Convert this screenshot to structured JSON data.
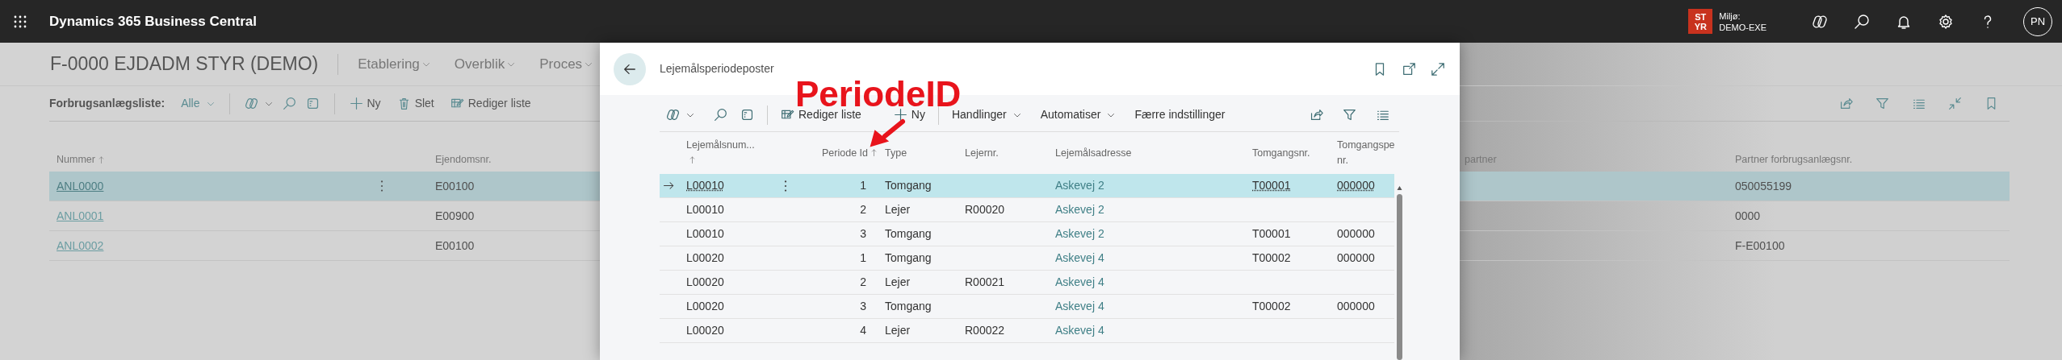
{
  "app_bar": {
    "title": "Dynamics 365 Business Central",
    "environment": {
      "badge_lines": [
        "ST",
        "YR"
      ],
      "label": "Miljø:",
      "name": "DEMO-EXE"
    },
    "avatar": "PN"
  },
  "page": {
    "title": "F-0000 EJDADM STYR (DEMO)",
    "nav": [
      {
        "label": "Etablering"
      },
      {
        "label": "Overblik"
      },
      {
        "label": "Proces"
      }
    ],
    "toolbar": {
      "list_label": "Forbrugsanlægsliste:",
      "filter": "Alle",
      "actions": [
        {
          "kind": "new",
          "label": "Ny"
        },
        {
          "kind": "delete",
          "label": "Slet"
        },
        {
          "kind": "edit",
          "label": "Rediger liste"
        }
      ]
    },
    "table": {
      "columns": [
        {
          "label": "Nummer",
          "sorted": true
        },
        {
          "label": "Ejendomsnr.",
          "sorted": false
        },
        {
          "label": "partner",
          "sorted": false
        },
        {
          "label": "Partner forbrugsanlægsnr.",
          "sorted": false
        }
      ],
      "rows": [
        {
          "selected": true,
          "number": "ANL0000",
          "property": "E00100",
          "partner_number": "050055199"
        },
        {
          "selected": false,
          "number": "ANL0001",
          "property": "E00900",
          "partner_number": "0000"
        },
        {
          "selected": false,
          "number": "ANL0002",
          "property": "E00100",
          "partner_number": "F-E00100"
        }
      ]
    }
  },
  "dialog": {
    "title": "Lejemålsperiodeposter",
    "toolbar": {
      "actions": [
        {
          "kind": "edit",
          "label": "Rediger liste"
        },
        {
          "kind": "new",
          "label": "Ny"
        }
      ],
      "menus": [
        {
          "label": "Handlinger"
        },
        {
          "label": "Automatiser"
        }
      ],
      "less": "Færre indstillinger"
    },
    "table": {
      "columns": [
        {
          "label": "Lejemålsnum...",
          "sorted": true
        },
        {
          "label": "Periode Id",
          "sorted": true
        },
        {
          "label": "Type",
          "sorted": false
        },
        {
          "label": "Lejernr.",
          "sorted": false
        },
        {
          "label": "Lejemålsadresse",
          "sorted": false
        },
        {
          "label": "Tomgangsnr.",
          "sorted": false
        },
        {
          "label": "Tomgangspe",
          "line2": "nr.",
          "sorted": false
        }
      ],
      "rows": [
        {
          "selected": true,
          "lease": "L00010",
          "period": "1",
          "type": "Tomgang",
          "address": "Askevej 2",
          "vacancy": "T00001",
          "vacancy_period": "000000"
        },
        {
          "selected": false,
          "lease": "L00010",
          "period": "2",
          "type": "Lejer",
          "tenant": "R00020",
          "address": "Askevej 2"
        },
        {
          "selected": false,
          "lease": "L00010",
          "period": "3",
          "type": "Tomgang",
          "address": "Askevej 2",
          "vacancy": "T00001",
          "vacancy_period": "000000"
        },
        {
          "selected": false,
          "lease": "L00020",
          "period": "1",
          "type": "Tomgang",
          "address": "Askevej 4",
          "vacancy": "T00002",
          "vacancy_period": "000000"
        },
        {
          "selected": false,
          "lease": "L00020",
          "period": "2",
          "type": "Lejer",
          "tenant": "R00021",
          "address": "Askevej 4"
        },
        {
          "selected": false,
          "lease": "L00020",
          "period": "3",
          "type": "Tomgang",
          "address": "Askevej 4",
          "vacancy": "T00002",
          "vacancy_period": "000000"
        },
        {
          "selected": false,
          "lease": "L00020",
          "period": "4",
          "type": "Lejer",
          "tenant": "R00022",
          "address": "Askevej 4"
        }
      ]
    }
  },
  "annotation": {
    "label": "PeriodeID"
  }
}
